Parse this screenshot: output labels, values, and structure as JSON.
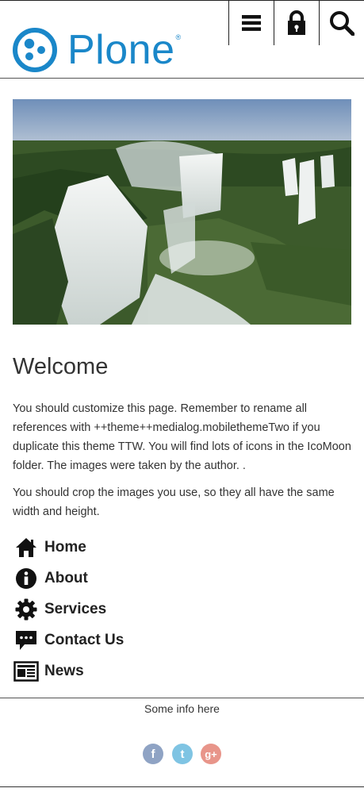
{
  "header": {
    "logo_text": "Plone",
    "logo_reg": "®",
    "brand_color": "#1a87c9"
  },
  "icons": {
    "menu": "hamburger-icon",
    "login": "lock-icon",
    "search": "search-icon"
  },
  "hero": {
    "alt": "waterfall-image"
  },
  "main": {
    "title": "Welcome",
    "paragraph1": "You should customize this page. Remember to rename all references with ++theme++medialog.mobilethemeTwo if you duplicate this theme TTW. You will find lots of icons in the IcoMoon folder. The images were taken by the author. .",
    "paragraph2": "You should crop the images you use, so they all have the same width and height."
  },
  "nav": [
    {
      "label": "Home",
      "icon": "home-icon"
    },
    {
      "label": "About",
      "icon": "info-icon"
    },
    {
      "label": "Services",
      "icon": "gear-icon"
    },
    {
      "label": "Contact Us",
      "icon": "chat-icon"
    },
    {
      "label": "News",
      "icon": "newspaper-icon"
    }
  ],
  "footer": {
    "info": "Some info here",
    "social": [
      {
        "name": "facebook",
        "glyph": "f",
        "color": "#8fa3c4"
      },
      {
        "name": "twitter",
        "glyph": "t",
        "color": "#7fc4e3"
      },
      {
        "name": "google-plus",
        "glyph": "g+",
        "color": "#e8958a"
      }
    ]
  }
}
